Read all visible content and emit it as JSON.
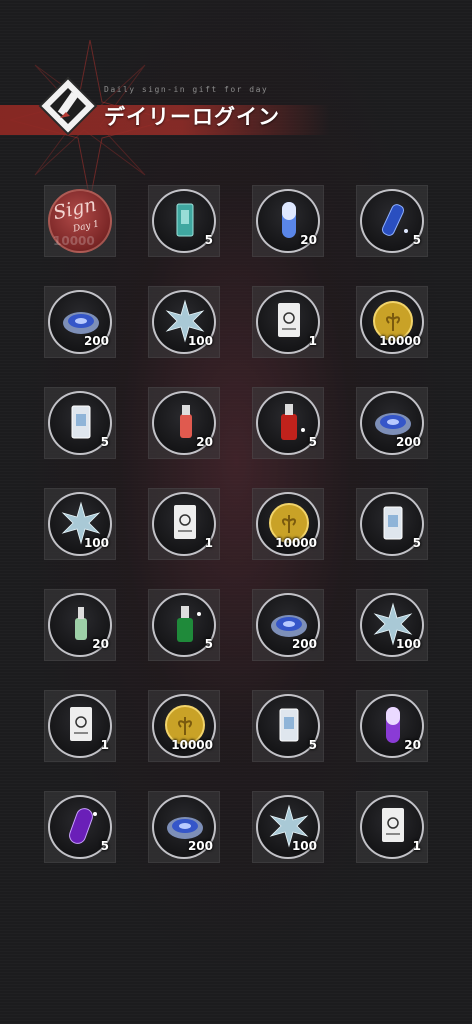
{
  "header": {
    "title": "デイリーログイン",
    "subtitle": "Daily sign-in gift for day",
    "emblem_icon": "pen-tool-emblem-icon"
  },
  "colors": {
    "accent_banner": "#8c2823",
    "ring": "#e1e1e6",
    "cell_bg": "#3c3c3e",
    "signed_stamp": "#b04a48"
  },
  "days": [
    {
      "item": "signed-stamp",
      "qty": "",
      "stamp": {
        "text": "Sign",
        "day": "Day 1",
        "ghost_qty": "10000"
      }
    },
    {
      "item": "teal-battery-icon",
      "qty": "5"
    },
    {
      "item": "blue-capsule-icon",
      "qty": "20"
    },
    {
      "item": "blue-vial-icon",
      "qty": "5"
    },
    {
      "item": "blue-disc-icon",
      "qty": "200"
    },
    {
      "item": "crystal-icon",
      "qty": "100"
    },
    {
      "item": "white-card-icon",
      "qty": "1"
    },
    {
      "item": "gold-coin-icon",
      "qty": "10000"
    },
    {
      "item": "white-battery-icon",
      "qty": "5"
    },
    {
      "item": "red-serum-icon",
      "qty": "20"
    },
    {
      "item": "red-serum-large-icon",
      "qty": "5"
    },
    {
      "item": "blue-disc-icon",
      "qty": "200"
    },
    {
      "item": "crystal-icon",
      "qty": "100"
    },
    {
      "item": "white-card-icon",
      "qty": "1"
    },
    {
      "item": "gold-coin-icon",
      "qty": "10000"
    },
    {
      "item": "white-battery-icon",
      "qty": "5"
    },
    {
      "item": "green-serum-icon",
      "qty": "20"
    },
    {
      "item": "green-serum-large-icon",
      "qty": "5"
    },
    {
      "item": "blue-disc-icon",
      "qty": "200"
    },
    {
      "item": "crystal-icon",
      "qty": "100"
    },
    {
      "item": "white-card-icon",
      "qty": "1"
    },
    {
      "item": "gold-coin-icon",
      "qty": "10000"
    },
    {
      "item": "white-battery-icon",
      "qty": "5"
    },
    {
      "item": "purple-capsule-icon",
      "qty": "20"
    },
    {
      "item": "purple-capsule-large-icon",
      "qty": "5"
    },
    {
      "item": "blue-disc-icon",
      "qty": "200"
    },
    {
      "item": "crystal-icon",
      "qty": "100"
    },
    {
      "item": "white-card-icon",
      "qty": "1"
    }
  ]
}
